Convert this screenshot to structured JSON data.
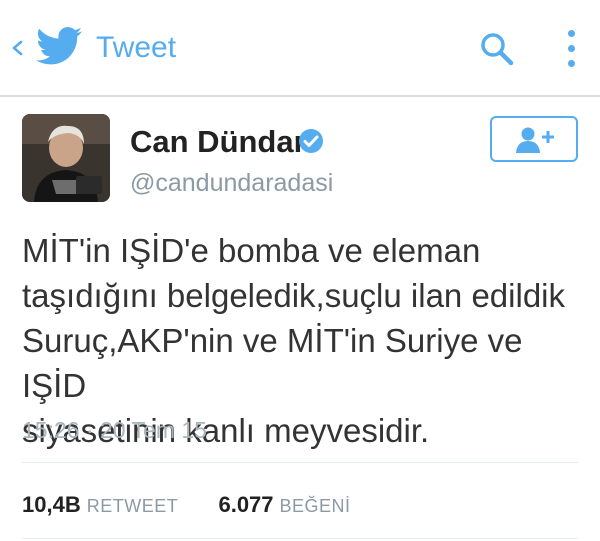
{
  "header": {
    "title": "Tweet",
    "back_icon": "chevron-left-icon",
    "logo_icon": "twitter-bird-icon",
    "search_icon": "search-icon",
    "more_icon": "more-vertical-icon",
    "accent_color": "#55acee"
  },
  "author": {
    "name": "Can Dündar",
    "handle": "@candundaradasi",
    "verified": true,
    "follow_icon": "follow-user-icon"
  },
  "tweet": {
    "text": "MİT'in IŞİD'e bomba ve eleman\ntaşıdığını belgeledik,suçlu ilan edildik\nSuruç,AKP'nin ve MİT'in Suriye ve IŞİD\nsiyasetinin kanlı meyvesidir.",
    "timestamp": "15:26 · 20 Tem 15"
  },
  "stats": {
    "retweets_count": "10,4B",
    "retweets_label": "RETWEET",
    "likes_count": "6.077",
    "likes_label": "BEĞENİ"
  }
}
